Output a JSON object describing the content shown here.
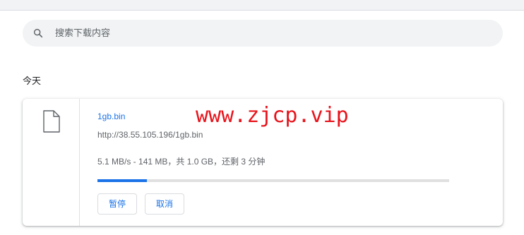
{
  "search": {
    "placeholder": "搜索下载内容"
  },
  "section": {
    "heading": "今天"
  },
  "download": {
    "file_name": "1gb.bin",
    "url": "http://38.55.105.196/1gb.bin",
    "status": "5.1 MB/s - 141 MB，共 1.0 GB，还剩 3 分钟",
    "progress_fraction": 0.141,
    "pause_label": "暂停",
    "cancel_label": "取消"
  },
  "watermark": {
    "text": "www.zjcp.vip"
  },
  "colors": {
    "accent": "#1a73e8",
    "watermark": "#e8141c"
  }
}
